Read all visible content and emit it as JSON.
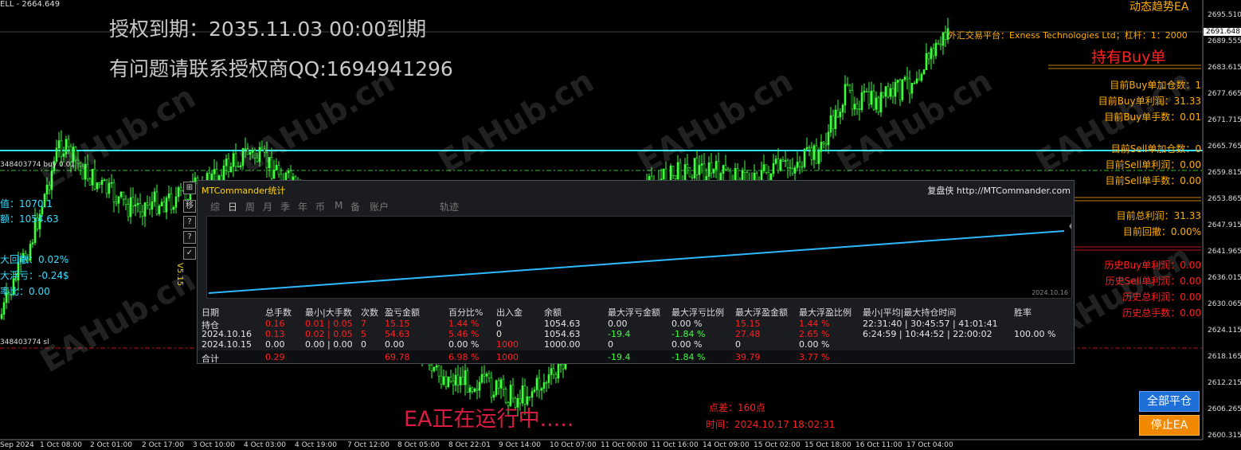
{
  "window": {
    "symbol_label": "ELL - 2664.649",
    "ea_name": "动态趋势EA"
  },
  "banner": {
    "license": "授权到期：2035.11.03 00:00到期",
    "contact": "有问题请联系授权商QQ:1694941296"
  },
  "watermark": "EAHub.cn",
  "right_panel": {
    "platform": "外汇交易平台：Exness Technologies Ltd；杠杆：1：2000",
    "holding_status": "持有Buy单",
    "rows": [
      {
        "label": "目前Buy单加仓数：1",
        "color": "orange"
      },
      {
        "label": "目前Buy单利润：31.33",
        "color": "orange"
      },
      {
        "label": "目前Buy单手数：0.01",
        "color": "orange"
      },
      {
        "label": "目前Sell单加仓数：0",
        "color": "orange"
      },
      {
        "label": "目前Sell单利润：0.00",
        "color": "orange"
      },
      {
        "label": "目前Sell单手数：0.00",
        "color": "orange"
      },
      {
        "label": "目前总利润：31.33",
        "color": "orange"
      },
      {
        "label": "目前回撤：0.00%",
        "color": "orange"
      },
      {
        "label": "历史Buy单利润：0.00",
        "color": "red"
      },
      {
        "label": "历史Sell单利润：0.00",
        "color": "red"
      },
      {
        "label": "历史总利润：0.00",
        "color": "red"
      },
      {
        "label": "历史总手数：0.00",
        "color": "red"
      }
    ]
  },
  "left_labels": {
    "order_buy": "348403774 buy 0.01",
    "order_sl": "348403774 sl",
    "value1": "值：1070.1",
    "value2": "额：1054.63",
    "max_dd": "大回撤：0.02%",
    "max_loss": "大浮亏：-0.24$",
    "ratio": "率比：0.00",
    "version": "V5.15"
  },
  "chart": {
    "current_price": "2691.648",
    "price_ticks": [
      "2695.510",
      "2689.555",
      "2683.615",
      "2677.665",
      "2671.715",
      "2665.765",
      "2659.815",
      "2653.865",
      "2647.915",
      "2641.965",
      "2636.015",
      "2630.065",
      "2624.115",
      "2618.165",
      "2612.215",
      "2606.265",
      "2600.315"
    ],
    "time_ticks": [
      "Sep 2024",
      "1 Oct 08:00",
      "2 Oct 01:00",
      "2 Oct 17:00",
      "3 Oct 10:00",
      "4 Oct 03:00",
      "4 Oct 19:00",
      "7 Oct 12:00",
      "8 Oct 05:00",
      "8 Oct 22:01",
      "9 Oct 14:00",
      "10 Oct 07:00",
      "11 Oct 00:00",
      "11 Oct 16:00",
      "14 Oct 09:00",
      "15 Oct 02:00",
      "15 Oct 18:00",
      "16 Oct 11:00",
      "17 Oct 04:00"
    ],
    "bottom_status": "EA正在运行中.....",
    "spread": "点差：160点",
    "time": "时间：2024.10.17 18:02:31"
  },
  "stats": {
    "title": "MTCommander统计",
    "link": "复盘侠 http://MTCommander.com",
    "tabs": [
      "综",
      "日",
      "周",
      "月",
      "季",
      "年",
      "币",
      "M",
      "备",
      "账户",
      "轨迹"
    ],
    "active_tab": "日",
    "mini_chart_date": "2024.10.16",
    "columns": [
      "日期",
      "总手数",
      "最小|大手数",
      "次数",
      "盈亏金额",
      "百分比%",
      "出入金",
      "余额",
      "最大浮亏金额",
      "最大浮亏比例",
      "最大浮盈金额",
      "最大浮盈比例",
      "最小|平均|最大持仓时间",
      "胜率"
    ],
    "rows": [
      [
        "持仓",
        "0.16",
        "0.01 | 0.05",
        "7",
        "15.15",
        "1.44 %",
        "0",
        "1054.63",
        "0.00",
        "0.00 %",
        "15.15",
        "1.44 %",
        "22:31:40 | 30:45:57 | 41:01:41",
        ""
      ],
      [
        "2024.10.16",
        "0.13",
        "0.02 | 0.05",
        "5",
        "54.63",
        "5.46 %",
        "0",
        "1054.63",
        "-19.4",
        "-1.84 %",
        "27.48",
        "2.65 %",
        "6:24:59 | 10:44:52 | 22:00:02",
        "100.00 %"
      ],
      [
        "2024.10.15",
        "0.00",
        "0.00 | 0.00",
        "0",
        "0.00",
        "0.00 %",
        "1000",
        "1000.00",
        "0",
        "0.00 %",
        "0",
        "0.00 %",
        "",
        ""
      ]
    ],
    "total": [
      "合计",
      "0.29",
      "",
      "",
      "69.78",
      "6.98 %",
      "1000",
      "",
      "-19.4",
      "-1.84 %",
      "39.79",
      "3.77 %",
      "",
      ""
    ],
    "side_buttons": [
      "移",
      "?",
      "?"
    ]
  },
  "buttons": {
    "close_all": "全部平仓",
    "stop_ea": "停止EA"
  },
  "colors": {
    "bull_candle": "#3dff3d",
    "bear_candle": "#3dff3d",
    "cyan_line": "#2fe0ff",
    "orange": "#ffae00",
    "red": "#ff2020",
    "close_btn": "#1e6fd8",
    "stop_btn": "#f08800"
  }
}
